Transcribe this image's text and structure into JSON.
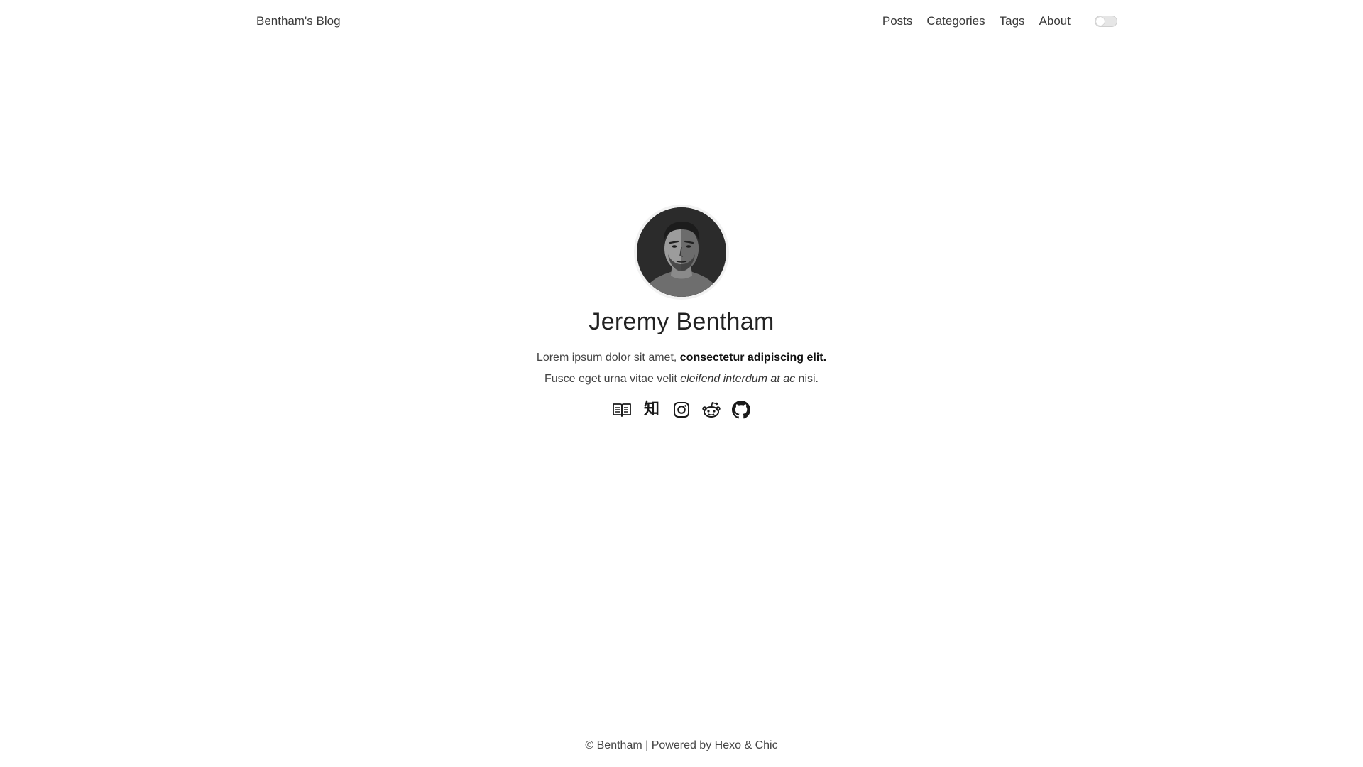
{
  "header": {
    "site_title": "Bentham's Blog",
    "nav": [
      {
        "label": "Posts"
      },
      {
        "label": "Categories"
      },
      {
        "label": "Tags"
      },
      {
        "label": "About"
      }
    ],
    "theme_toggle": {
      "state": "off"
    }
  },
  "profile": {
    "avatar": {
      "icon": "person-photo",
      "style": "grayscale"
    },
    "name": "Jeremy Bentham",
    "bio": {
      "line1_plain": "Lorem ipsum dolor sit amet, ",
      "line1_bold": "consectetur adipiscing elit.",
      "line2_plain_start": "Fusce eget urna vitae velit ",
      "line2_italic": "eleifend interdum at ac",
      "line2_plain_end": " nisi."
    },
    "social": [
      {
        "icon": "book-icon"
      },
      {
        "icon": "zhihu-icon",
        "glyph": "知"
      },
      {
        "icon": "instagram-icon"
      },
      {
        "icon": "reddit-icon"
      },
      {
        "icon": "github-icon"
      }
    ]
  },
  "footer": {
    "copyright": "© Bentham | Powered by ",
    "hexo": "Hexo",
    "amp": " & ",
    "chic": "Chic"
  },
  "colors": {
    "background": "#ffffff",
    "text": "#333333",
    "heading": "#222222"
  }
}
